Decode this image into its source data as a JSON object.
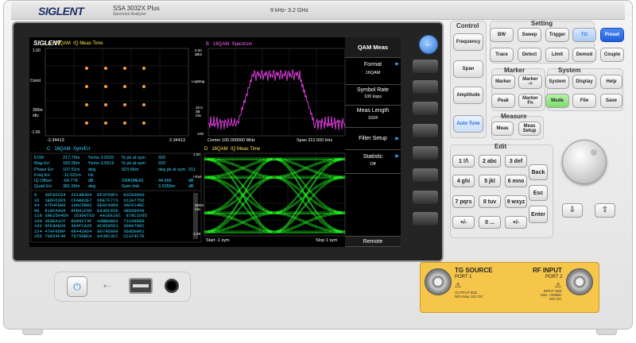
{
  "device": {
    "brand": "SIGLENT",
    "model": "SSA 3032X Plus",
    "subtitle": "Spectrum Analyzer",
    "freq_range": "9 kHz- 3.2 GHz"
  },
  "screen": {
    "logo": "SIGLENT",
    "panelA": {
      "title": "> A   16QAM  IQ Meas Time",
      "ytop": "1.50",
      "ymid": "Const",
      "yunit": "300m\n/div",
      "ybot": "-1.50",
      "xleft": "-2.34413",
      "xright": "2.34413"
    },
    "panelB": {
      "title": "B   16QAM  Spectrum",
      "ytop": "0.00\ndBm",
      "ymid": "LogMag",
      "yunit": "10.0\ndB\n/div",
      "ybot": "-100",
      "xleft": "Center 100.000000 MHz",
      "xright": "Span 312.500 kHz"
    },
    "panelC": {
      "title": "C   16QAM  Sym/Err",
      "rows": [
        [
          "EVM",
          "217.79m",
          "%rms 3.5520",
          "% pk at sym",
          "920"
        ],
        [
          "Mag Err",
          "182.06m",
          "%rms 3.5519",
          "% pk at sym",
          "920"
        ],
        [
          "Phase Err",
          "107.51m",
          "deg",
          "923.66m",
          "deg pk at sym",
          "211"
        ],
        [
          "Freq Err",
          "-11.021m",
          "Hz",
          "",
          "",
          ""
        ],
        [
          "IQ Offset",
          "-64.778",
          "dB",
          "SNR(MER)",
          "44.666",
          "dB"
        ],
        [
          "Quad Err",
          "381.59m",
          "deg",
          "Gain Imb",
          "3.5359m",
          "dB"
        ]
      ],
      "symbols": [
        "0   3EF92C64  221AB3D4  DF2FD0FC  83CE0600",
        "32  1B6FD2E5  CFAB92E7  D6E7F773  312A7756",
        "64  A7D4FEB0  10ACDB02  DE8240D0  3AF014BC",
        "96  810FAA69  8FB91F6D  EA3DC656  3B569649",
        "128 38E2584D9  15308TED  AA1EE1EC  878C1D65",
        "160 3E9EA1CF  8A00ST4F  A9BBAB83  73108EB9",
        "192 0FE9A826  394FCA25  AC059551  30A6796C",
        "224 47AF9D0F  0E443AD4  8074D899  368D0001",
        "256 70854F46  78750BCA  0438C3CC  CC1F4C7E"
      ]
    },
    "panelD": {
      "title": "D   16QAM  IQ Meas Time",
      "ytop": "1.50",
      "ymid": "I-Eye",
      "yunit": "300m\n/div",
      "ybot": "-1.50",
      "xleft": "Start -1 sym",
      "xright": "Stop 1 sym"
    },
    "softkeys": {
      "title": "QAM Meas",
      "format_label": "Format",
      "format_value": "16QAM",
      "symrate_label": "Symbol Rate",
      "symrate_value": "100 ksps",
      "measlen_label": "Meas Length",
      "measlen_value": "1024",
      "filter_label": "Filter Setup",
      "statistic_label": "Statistic",
      "statistic_value": "Off",
      "remote_label": "Remote"
    }
  },
  "panel": {
    "control_title": "Control",
    "setting_title": "Setting",
    "marker_title": "Marker",
    "system_title": "System",
    "measure_title": "Measure",
    "edit_title": "Edit",
    "control_keys": [
      "Frequency",
      "Span",
      "Amplitude",
      "Auto Tune"
    ],
    "setting_row1": [
      "BW",
      "Sweep",
      "Trigger",
      "TG",
      "Preset"
    ],
    "setting_row2": [
      "Trace",
      "Detect",
      "Limit",
      "Demod",
      "Couple"
    ],
    "marker_keys": [
      "Marker",
      "Marker\n->",
      "Peak",
      "Marker\nFn"
    ],
    "system_keys": [
      "System",
      "Display",
      "Mode",
      "File",
      "Help",
      "Save"
    ],
    "measure_keys": [
      "Meas",
      "Meas\nSetup"
    ],
    "num_keys": [
      "1 !/\\",
      "2 abc",
      "3 def",
      "4 ghi",
      "5 jkl",
      "6 mno",
      "7 pqrs",
      "8 tuv",
      "9 wxyz",
      "+/- ",
      "0 ...",
      "+/-"
    ],
    "edit_keys": [
      "Back",
      "Esc",
      "Enter"
    ],
    "tg_source": "TG SOURCE",
    "tg_port": "PORT 1",
    "tg_spec": "OUTPUT 50Ω\nREV.Max 10V DC",
    "rf_input": "RF INPUT",
    "rf_port": "PORT 2",
    "rf_spec": "INPUT 50Ω\nMax +30dBm\n50V DC"
  },
  "colors": {
    "trace_green": "#22ff22",
    "trace_magenta": "#ff44ff",
    "tg_blue": "#2f7de1",
    "preset_blue": "#1f5fe0",
    "mode_green": "#7ddc6a",
    "port_gold": "#f6c64a"
  }
}
